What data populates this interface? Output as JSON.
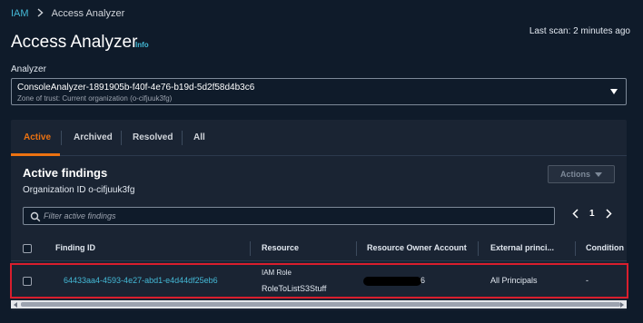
{
  "breadcrumb": {
    "root": "IAM",
    "current": "Access Analyzer"
  },
  "page": {
    "title": "Access Analyzer",
    "info": "Info",
    "last_scan": "Last scan: 2 minutes ago"
  },
  "analyzer": {
    "label": "Analyzer",
    "name": "ConsoleAnalyzer-1891905b-f40f-4e76-b19d-5d2f58d4b3c6",
    "zone": "Zone of trust: Current organization (o-cifjuuk3fg)"
  },
  "tabs": [
    {
      "label": "Active",
      "active": true
    },
    {
      "label": "Archived",
      "active": false
    },
    {
      "label": "Resolved",
      "active": false
    },
    {
      "label": "All",
      "active": false
    }
  ],
  "findings": {
    "title": "Active findings",
    "org_id": "Organization ID o-cifjuuk3fg",
    "actions_label": "Actions",
    "filter_placeholder": "Filter active findings",
    "page": "1"
  },
  "table": {
    "columns": [
      "Finding ID",
      "Resource",
      "Resource Owner Account",
      "External princi...",
      "Condition"
    ],
    "rows": [
      {
        "finding_id": "64433aa4-4593-4e27-abd1-e4d44df25eb6",
        "resource_type": "IAM Role",
        "resource_name": "RoleToListS3Stuff",
        "owner_account_suffix": "6",
        "external_principal": "All Principals",
        "condition": "-"
      }
    ]
  },
  "colors": {
    "background": "#0f1b2a",
    "panel": "#1a2433",
    "accent": "#ec7211",
    "link": "#44b9d6",
    "highlight": "#d91e2d"
  }
}
